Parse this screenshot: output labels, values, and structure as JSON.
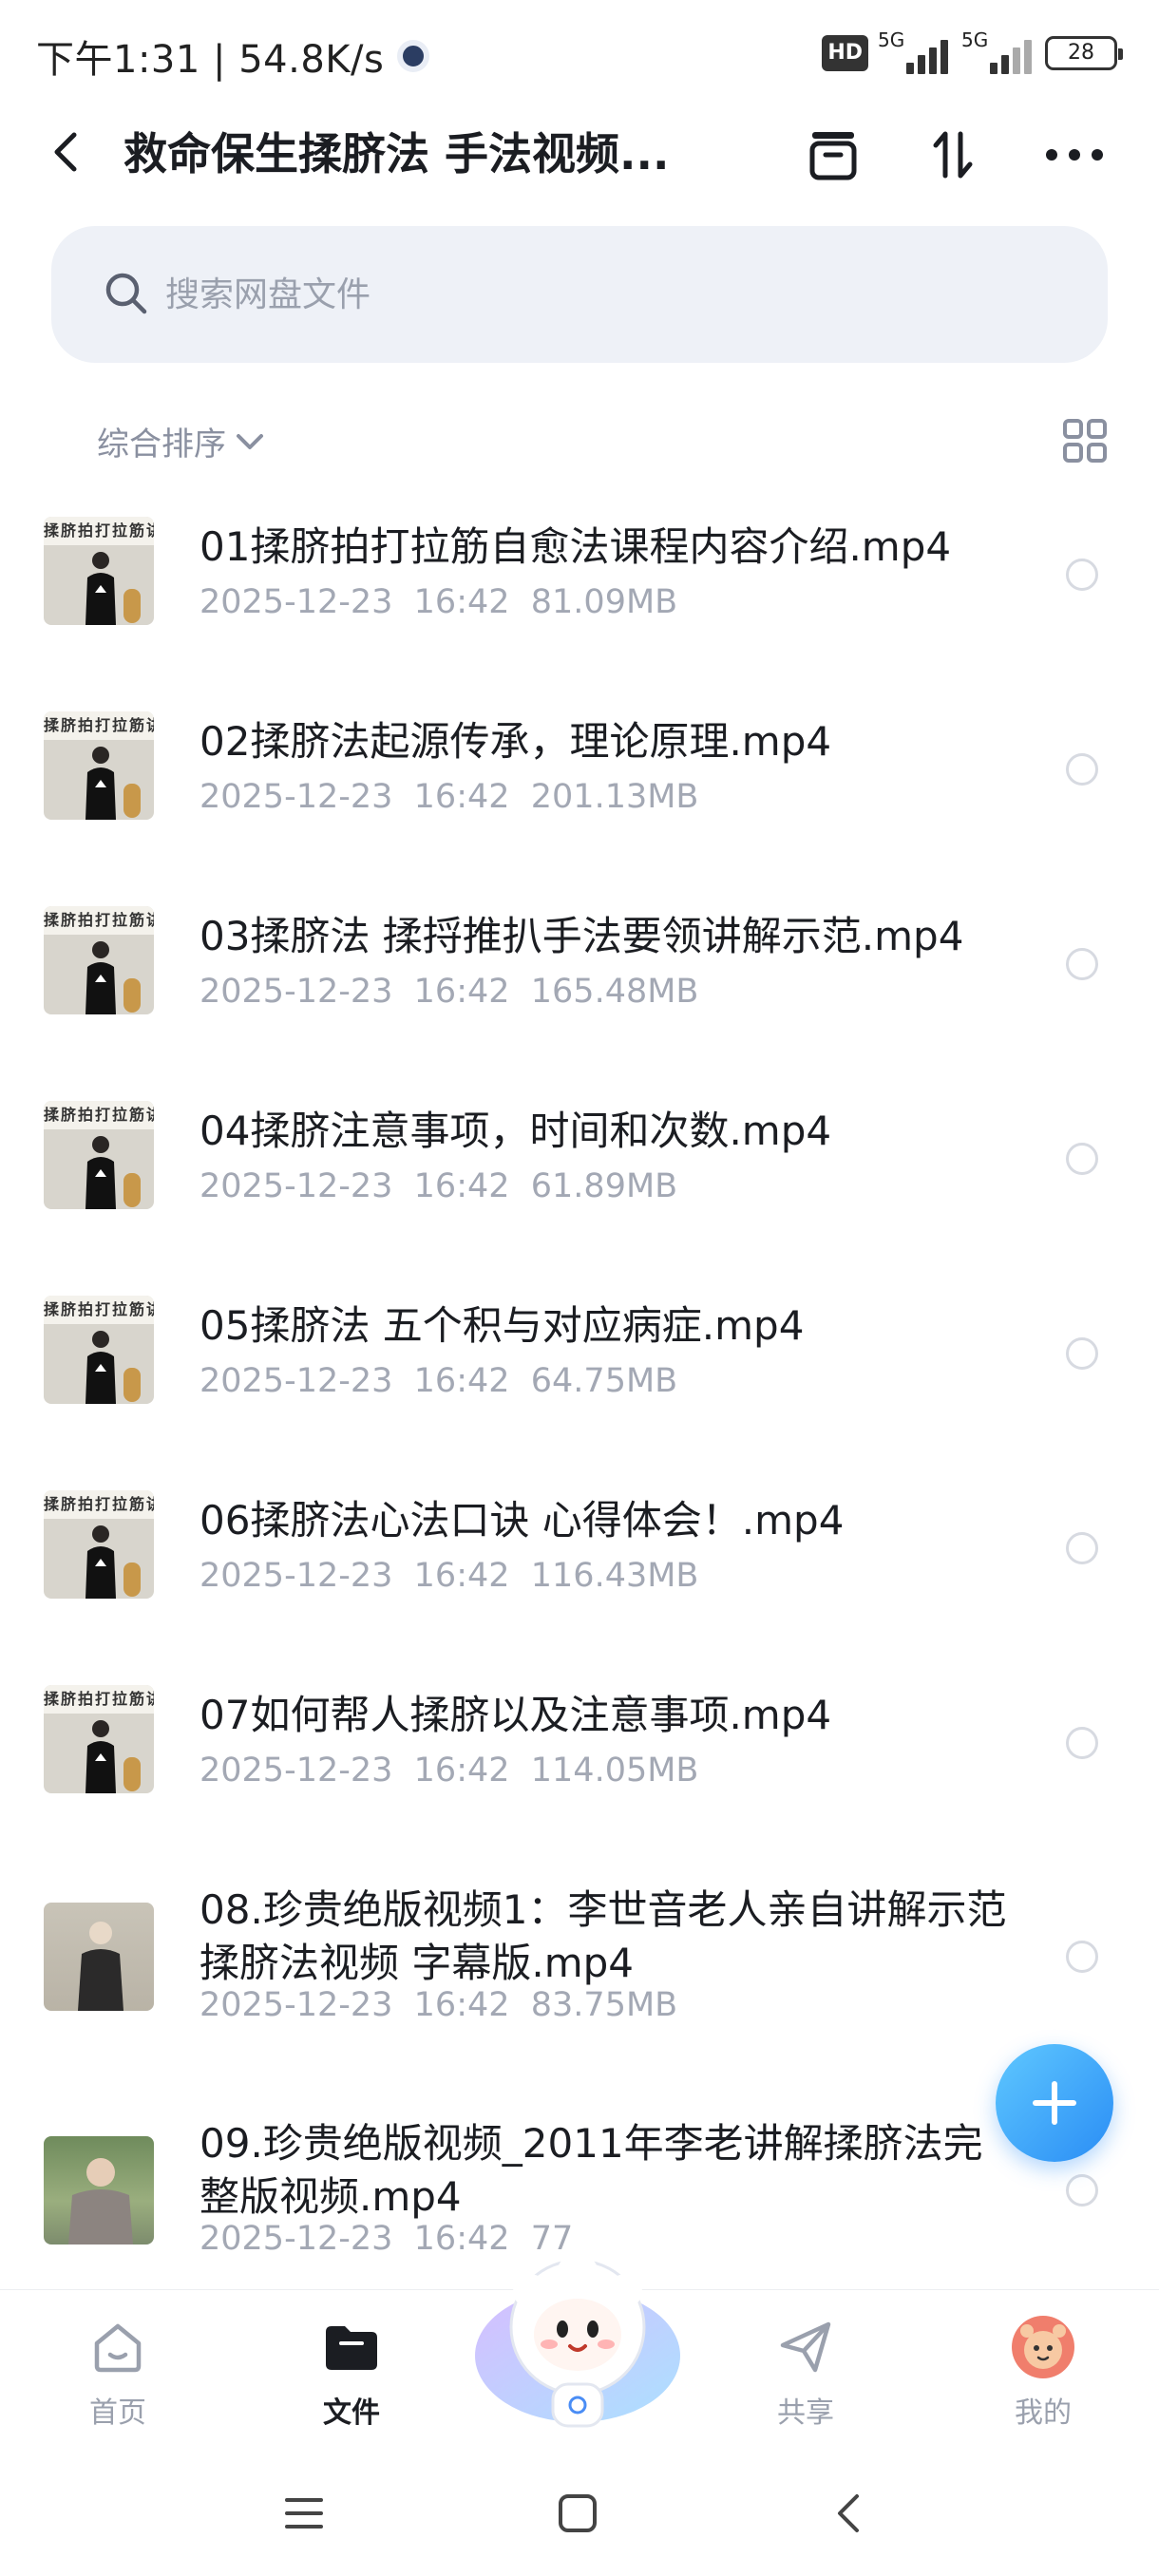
{
  "status_bar": {
    "time_speed": "下午1:31 | 54.8K/s",
    "hd_badge": "HD",
    "sim1": "5G",
    "sim2": "5G",
    "battery": "28"
  },
  "header": {
    "title": "救命保生揉脐法 手法视频...",
    "icons": [
      "back-arrow-icon",
      "archive-box-icon",
      "sort-arrows-icon",
      "more-dots-icon"
    ]
  },
  "search": {
    "placeholder": "搜索网盘文件"
  },
  "sort": {
    "label": "综合排序"
  },
  "files": [
    {
      "name": "01揉脐拍打拉筋自愈法课程内容介绍.mp4",
      "meta": "2025-12-23  16:42  81.09MB"
    },
    {
      "name": "02揉脐法起源传承，理论原理.mp4",
      "meta": "2025-12-23  16:42  201.13MB"
    },
    {
      "name": "03揉脐法 揉捋推扒手法要领讲解示范.mp4",
      "meta": "2025-12-23  16:42  165.48MB"
    },
    {
      "name": "04揉脐注意事项，时间和次数.mp4",
      "meta": "2025-12-23  16:42  61.89MB"
    },
    {
      "name": "05揉脐法 五个积与对应病症.mp4",
      "meta": "2025-12-23  16:42  64.75MB"
    },
    {
      "name": "06揉脐法心法口诀 心得体会！.mp4",
      "meta": "2025-12-23  16:42  116.43MB"
    },
    {
      "name": "07如何帮人揉脐以及注意事项.mp4",
      "meta": "2025-12-23  16:42  114.05MB"
    },
    {
      "name": "08.珍贵绝版视频1：李世音老人亲自讲解示范揉脐法视频  字幕版.mp4",
      "meta": "2025-12-23  16:42  83.75MB"
    },
    {
      "name": "09.珍贵绝版视频_2011年李老讲解揉脐法完整版视频.mp4",
      "meta": "2025-12-23  16:42  77"
    }
  ],
  "thumb_banner": "揉脐拍打拉筋讲",
  "bottom_nav": {
    "home": "首页",
    "files": "文件",
    "share": "共享",
    "mine": "我的"
  }
}
